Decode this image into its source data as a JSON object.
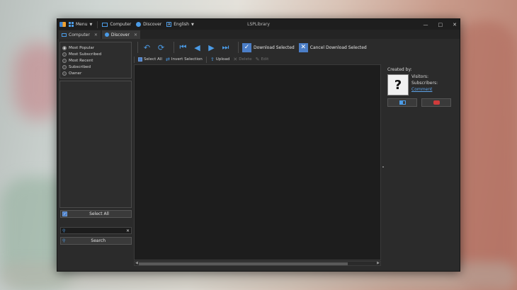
{
  "window": {
    "title": "LSPLibrary"
  },
  "titlebar": {
    "menu_label": "Menu",
    "computer_label": "Computer",
    "discover_label": "Discover",
    "language_label": "English",
    "language_icon_letter": "A"
  },
  "window_controls": {
    "minimize": "—",
    "maximize": "□",
    "close": "✕"
  },
  "tabs": [
    {
      "label": "Computer",
      "icon": "monitor-icon",
      "active": false
    },
    {
      "label": "Discover",
      "icon": "discover-icon",
      "active": true
    }
  ],
  "filters": {
    "options": [
      "Most Popular",
      "Most Subscribed",
      "Most Recent",
      "Subscribed",
      "Owner"
    ],
    "selected": "Most Popular"
  },
  "left": {
    "select_all_label": "Select All",
    "search_value": "",
    "search_button_label": "Search"
  },
  "toolbar": {
    "download_selected_label": "Download Selected",
    "cancel_download_selected_label": "Cancel Download Selected"
  },
  "subtoolbar": {
    "select_all_label": "Select All",
    "invert_selection_label": "Invert Selection",
    "upload_label": "Upload",
    "delete_label": "Delete",
    "edit_label": "Edit"
  },
  "details": {
    "created_by_label": "Created by:",
    "avatar_placeholder": "?",
    "visitors_label": "Visitors:",
    "subscribers_label": "Subscribers:",
    "comment_link": "Comment"
  },
  "colors": {
    "accent": "#4b9be6",
    "danger": "#cf3b3b"
  }
}
